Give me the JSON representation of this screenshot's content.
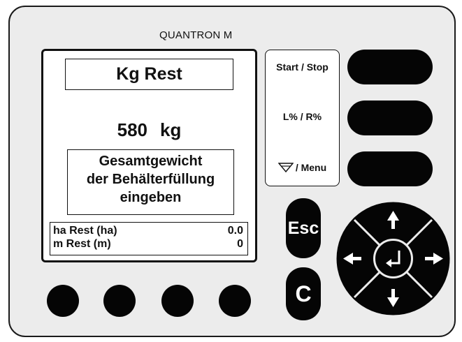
{
  "device": {
    "brand": "QUANTRON M"
  },
  "display": {
    "title": "Kg Rest",
    "value": "580",
    "unit": "kg",
    "message": [
      "Gesamtgewicht",
      "der Behälterfüllung",
      "eingeben"
    ],
    "info": [
      {
        "label": "ha Rest (ha)",
        "value": "0.0"
      },
      {
        "label": "m Rest (m)",
        "value": "0"
      }
    ]
  },
  "side_buttons": {
    "labels": [
      "Start / Stop",
      "L% / R%",
      "/ Menu"
    ],
    "menu_icon": "funnel-icon"
  },
  "keys": {
    "esc": "Esc",
    "clear": "C"
  },
  "navigation": {
    "up_icon": "arrow-up-icon",
    "down_icon": "arrow-down-icon",
    "left_icon": "arrow-left-icon",
    "right_icon": "arrow-right-icon",
    "enter_icon": "enter-icon"
  },
  "colors": {
    "panel": "#ececec",
    "buttons": "#050505",
    "screen": "#ffffff",
    "outline": "#111111"
  }
}
